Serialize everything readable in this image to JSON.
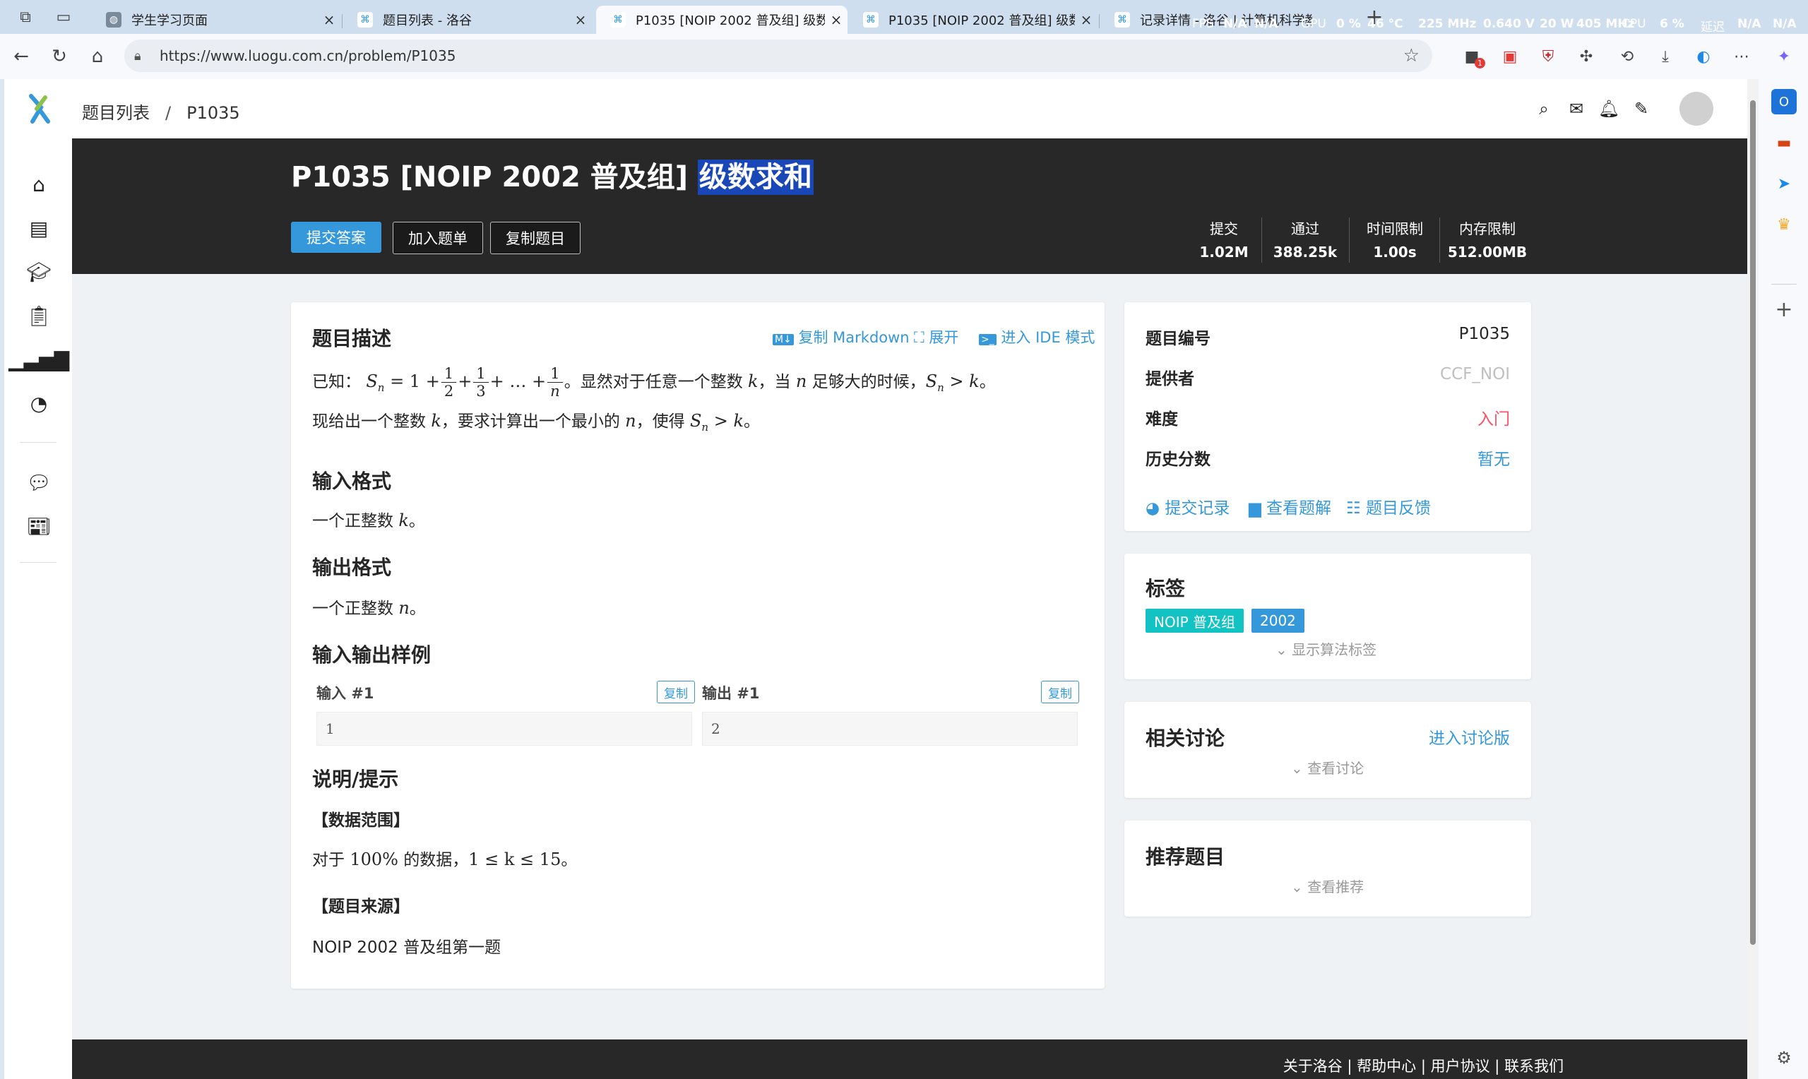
{
  "browser": {
    "tabs": [
      {
        "title": "学生学习页面",
        "active": false
      },
      {
        "title": "题目列表 - 洛谷",
        "active": false
      },
      {
        "title": "P1035 [NOIP 2002 普及组] 级数求和 - 洛谷",
        "active": true
      },
      {
        "title": "P1035 [NOIP 2002 普及组] 级数求和 - 洛谷",
        "active": false
      },
      {
        "title": "记录详情 - 洛谷 | 计算机科学教育新生态",
        "active": false
      }
    ],
    "new_tab": "+",
    "url": "https://www.luogu.com.cn/problem/P1035",
    "overlay": {
      "fps_label": "FPS",
      "fps_val1": "N/A",
      "fps_val2": "N/A",
      "gpu_label": "GPU",
      "gpu_val": "0 %",
      "temp": "46 °C",
      "gpu_clock": "225 MHz",
      "voltage": "0.640 V",
      "power": "20 W",
      "mem_clock": "405 MHz",
      "cpu_label": "CPU",
      "cpu_val": "6 %",
      "latency_label": "延迟",
      "latency_val": "N/A",
      "extra_val": "N/A"
    },
    "ext_badge": "1"
  },
  "colors": {
    "accent": "#3498db",
    "banner": "#282828",
    "difficulty": "#fe4c61",
    "provider": "#bfbfbf",
    "tag_noip": "#13c2c2",
    "tag_year": "#3498db"
  },
  "topnav": {
    "breadcrumb_parent": "题目列表",
    "breadcrumb_sep": "/",
    "breadcrumb_current": "P1035",
    "icons": [
      "search-icon",
      "mail-icon",
      "bell-icon",
      "pen-icon"
    ]
  },
  "leftnav": [
    "home-icon",
    "book-icon",
    "graduation-icon",
    "clipboard-icon",
    "bar-chart-icon",
    "pie-chart-icon",
    "chat-icon",
    "news-icon"
  ],
  "problem": {
    "title_prefix": "P1035 [NOIP 2002 普及组] ",
    "title_highlight": "级数求和",
    "buttons": {
      "submit": "提交答案",
      "add_list": "加入题单",
      "copy": "复制题目"
    },
    "stats": [
      {
        "label": "提交",
        "value": "1.02M"
      },
      {
        "label": "通过",
        "value": "388.25k"
      },
      {
        "label": "时间限制",
        "value": "1.00s"
      },
      {
        "label": "内存限制",
        "value": "512.00MB"
      }
    ]
  },
  "content": {
    "desc_heading": "题目描述",
    "toolbar": {
      "copy_md": "复制 Markdown",
      "expand": "展开",
      "ide": "进入 IDE 模式"
    },
    "desc_line1_prefix": "已知：",
    "desc_line1_suffix": "。显然对于任意一个整数",
    "desc_line1_when": "，当",
    "desc_line1_big": "足够大的时候，",
    "desc_line2_a": "现给出一个整数",
    "desc_line2_b": "，要求计算出一个最小的",
    "desc_line2_c": "，使得",
    "input_heading": "输入格式",
    "input_text": "一个正整数",
    "output_heading": "输出格式",
    "output_text": "一个正整数",
    "samples_heading": "输入输出样例",
    "sample_input_label": "输入 #1",
    "sample_output_label": "输出 #1",
    "copy_label": "复制",
    "sample_input": "1",
    "sample_output": "2",
    "hint_heading": "说明/提示",
    "range_heading": "【数据范围】",
    "range_text_a": "对于",
    "range_text_b": "的数据，",
    "range_pct": "100%",
    "range_expr": "1 ≤ k ≤ 15",
    "source_heading": "【题目来源】",
    "source_text": "NOIP 2002 普及组第一题"
  },
  "info": {
    "rows": [
      {
        "key": "题目编号",
        "value": "P1035"
      },
      {
        "key": "提供者",
        "value": "CCF_NOI"
      },
      {
        "key": "难度",
        "value": "入门"
      },
      {
        "key": "历史分数",
        "value": "暂无"
      }
    ],
    "actions": {
      "records": "提交记录",
      "solutions": "查看题解",
      "feedback": "题目反馈"
    }
  },
  "tags": {
    "heading": "标签",
    "items": [
      "NOIP 普及组",
      "2002"
    ],
    "show_algo": "显示算法标签"
  },
  "discussion": {
    "heading": "相关讨论",
    "enter": "进入讨论版",
    "view": "查看讨论"
  },
  "recommend": {
    "heading": "推荐题目",
    "view": "查看推荐"
  },
  "footer": {
    "links": "关于洛谷 | 帮助中心 | 用户协议 | 联系我们"
  }
}
